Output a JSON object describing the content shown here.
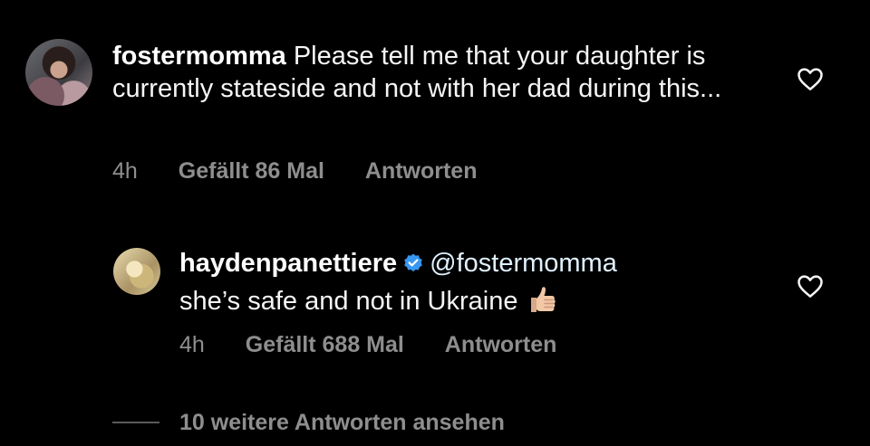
{
  "comments": [
    {
      "username": "fostermomma",
      "text": "Please tell me that your daughter is currently stateside and not with her dad during this...",
      "time": "4h",
      "likes": "Gefällt 86 Mal",
      "reply": "Antworten"
    },
    {
      "username": "haydenpanettiere",
      "mention": "@fostermomma",
      "text": "she’s safe and not in Ukraine",
      "time": "4h",
      "likes": "Gefällt 688 Mal",
      "reply": "Antworten"
    }
  ],
  "view_more": "10 weitere Antworten ansehen",
  "colors": {
    "background": "#000000",
    "meta": "#8e8e8e",
    "verified": "#3897f0"
  },
  "icons": [
    "avatar",
    "verified-badge-icon",
    "thumbs-up-emoji-icon",
    "heart-icon"
  ]
}
